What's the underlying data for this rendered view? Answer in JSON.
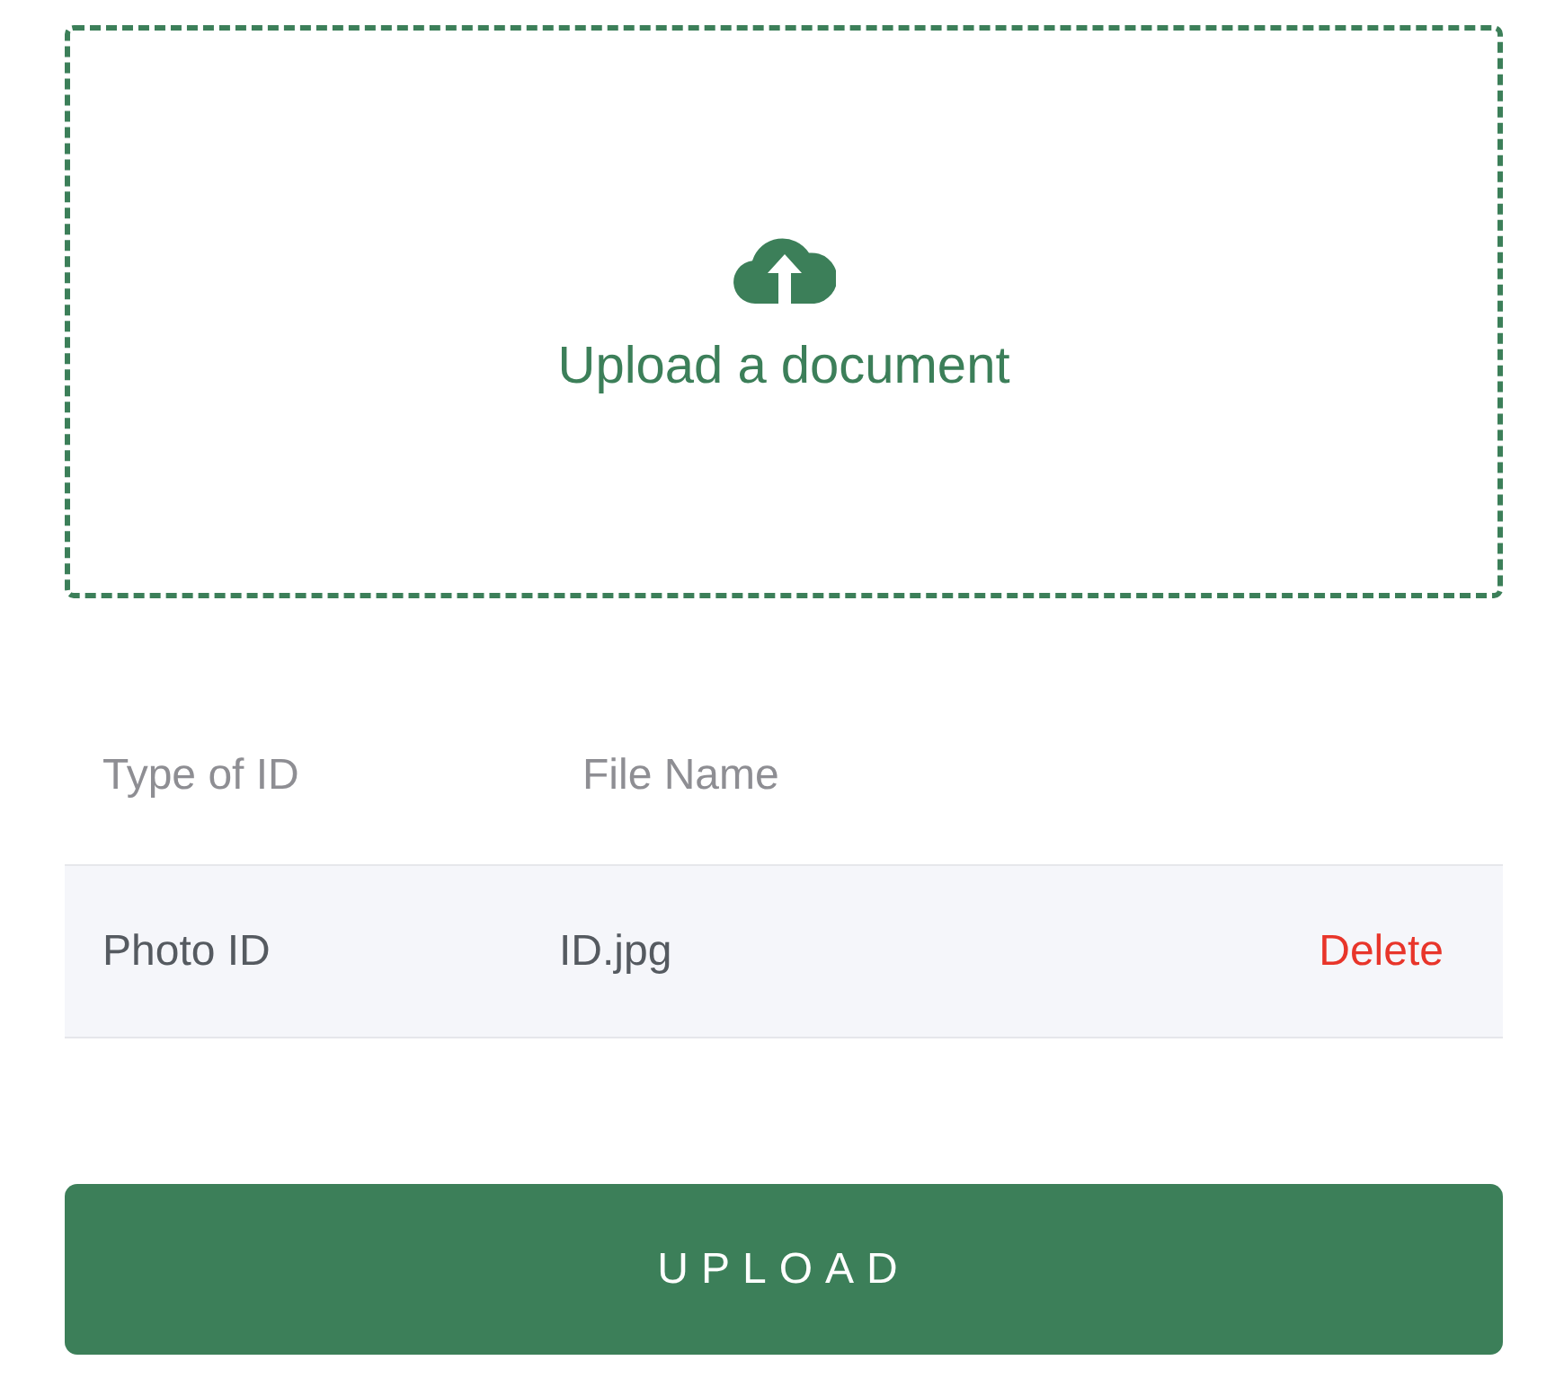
{
  "dropzone": {
    "label": "Upload a document"
  },
  "table": {
    "columns": [
      "Type of ID",
      "File Name"
    ],
    "rows": [
      {
        "type_of_id": "Photo ID",
        "file_name": "ID.jpg",
        "action": "Delete"
      }
    ]
  },
  "upload_button": {
    "label": "UPLOAD"
  }
}
